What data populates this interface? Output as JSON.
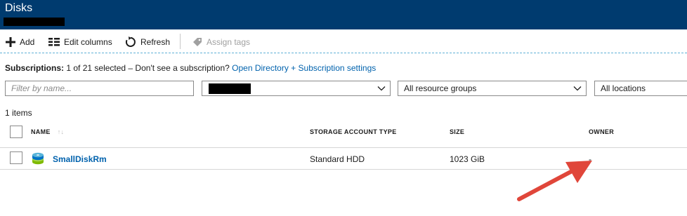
{
  "header": {
    "title": "Disks"
  },
  "toolbar": {
    "add_label": "Add",
    "edit_columns_label": "Edit columns",
    "refresh_label": "Refresh",
    "assign_tags_label": "Assign tags"
  },
  "subscriptions": {
    "label": "Subscriptions:",
    "text": "1 of 21 selected – Don't see a subscription?",
    "link": "Open Directory + Subscription settings"
  },
  "filters": {
    "name_placeholder": "Filter by name...",
    "resource_groups": "All resource groups",
    "locations": "All locations"
  },
  "list": {
    "count": "1 items",
    "columns": [
      "NAME",
      "STORAGE ACCOUNT TYPE",
      "SIZE",
      "OWNER"
    ],
    "rows": [
      {
        "name": "SmallDiskRm",
        "storage_type": "Standard HDD",
        "size": "1023 GiB",
        "owner": "-"
      }
    ]
  },
  "colors": {
    "header_bg": "#003b6f",
    "link": "#0062ad",
    "annotation_arrow": "#e0463a"
  },
  "icons": [
    "plus-icon",
    "columns-icon",
    "refresh-icon",
    "tag-icon",
    "chevron-down-icon",
    "disk-icon",
    "sort-icon"
  ]
}
